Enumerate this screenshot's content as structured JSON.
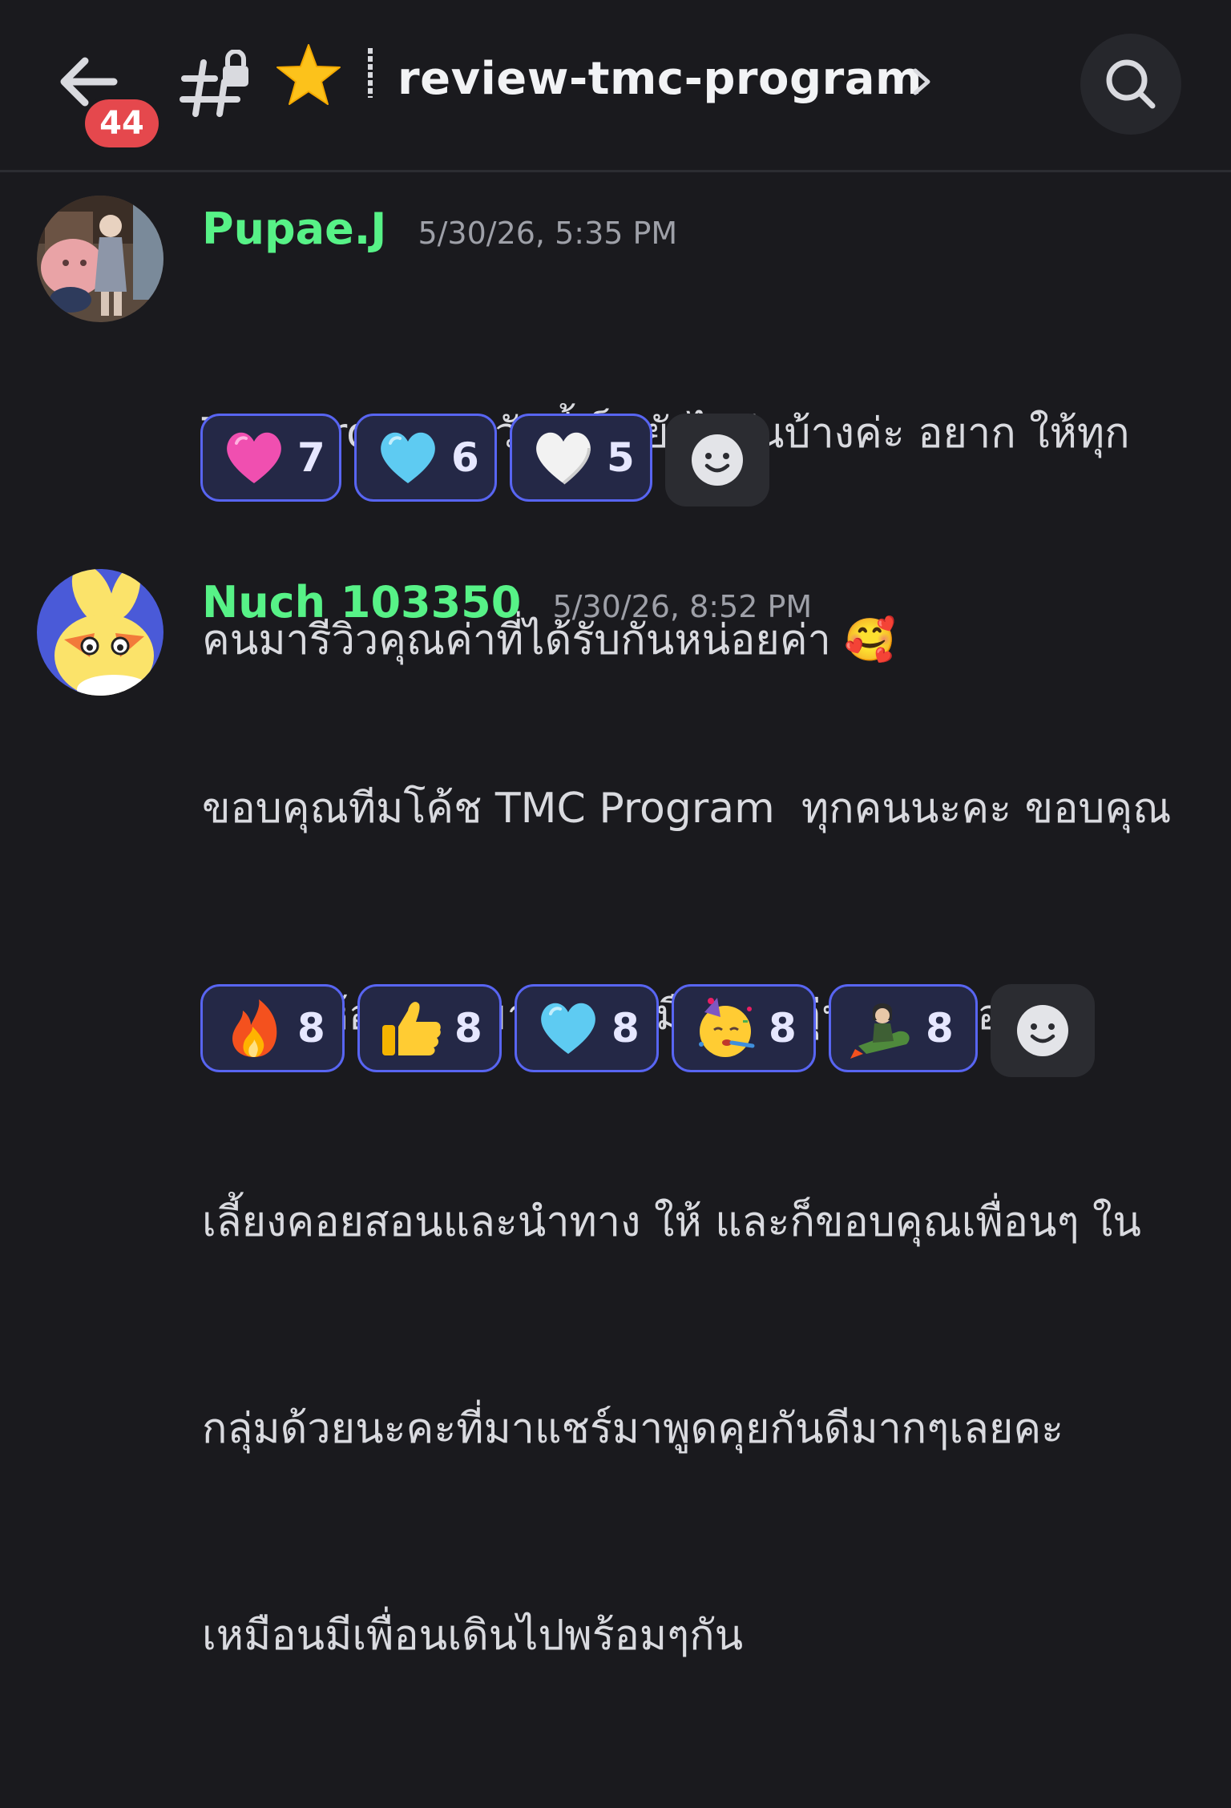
{
  "header": {
    "unread_badge": "44",
    "channel_name": "review-tmc-program"
  },
  "messages": [
    {
      "author": "Pupae.J",
      "timestamp": "5/30/26, 5:35 PM",
      "text_lines": [
        "TMC Program วันนี้เป็นยังไงกันบ้างค่ะ อยาก ให้ทุก",
        "คนมารีวิวคุณค่าที่ได้รับกันหน่อยค่า 🥰"
      ],
      "reactions": [
        {
          "emoji": "pink-heart",
          "count": "7"
        },
        {
          "emoji": "light-blue-heart",
          "count": "6"
        },
        {
          "emoji": "white-heart",
          "count": "5"
        }
      ]
    },
    {
      "author": "Nuch 103350",
      "timestamp": "5/30/26, 8:52 PM",
      "text_lines": [
        "ขอบคุณทีมโค้ช TMC Program  ทุกคนนะคะ ขอบคุณ",
        "ที่สร้างห้องนี้ขึ้นมา ทำ ให้มือ ใหม่อุ่น ใจเหมือนมีพี่",
        "เลี้ยงคอยสอนและนำทาง ให้ และก็ขอบคุณเพื่อนๆ ใน",
        "กลุ่มด้วยนะคะที่มาแชร์มาพูดคุยกันดีมากๆเลยคะ",
        "เหมือนมีเพื่อนเดินไปพร้อมๆกัน"
      ],
      "reactions": [
        {
          "emoji": "fire",
          "count": "8"
        },
        {
          "emoji": "thumbs-up",
          "count": "8"
        },
        {
          "emoji": "light-blue-heart",
          "count": "8"
        },
        {
          "emoji": "partying-face",
          "count": "8"
        },
        {
          "emoji": "custom-rocket-sticker",
          "count": "8"
        }
      ]
    }
  ],
  "colors": {
    "background": "#1a1a1e",
    "author": "#57f287",
    "reaction_border": "#5865f2",
    "badge": "#e5484d"
  }
}
